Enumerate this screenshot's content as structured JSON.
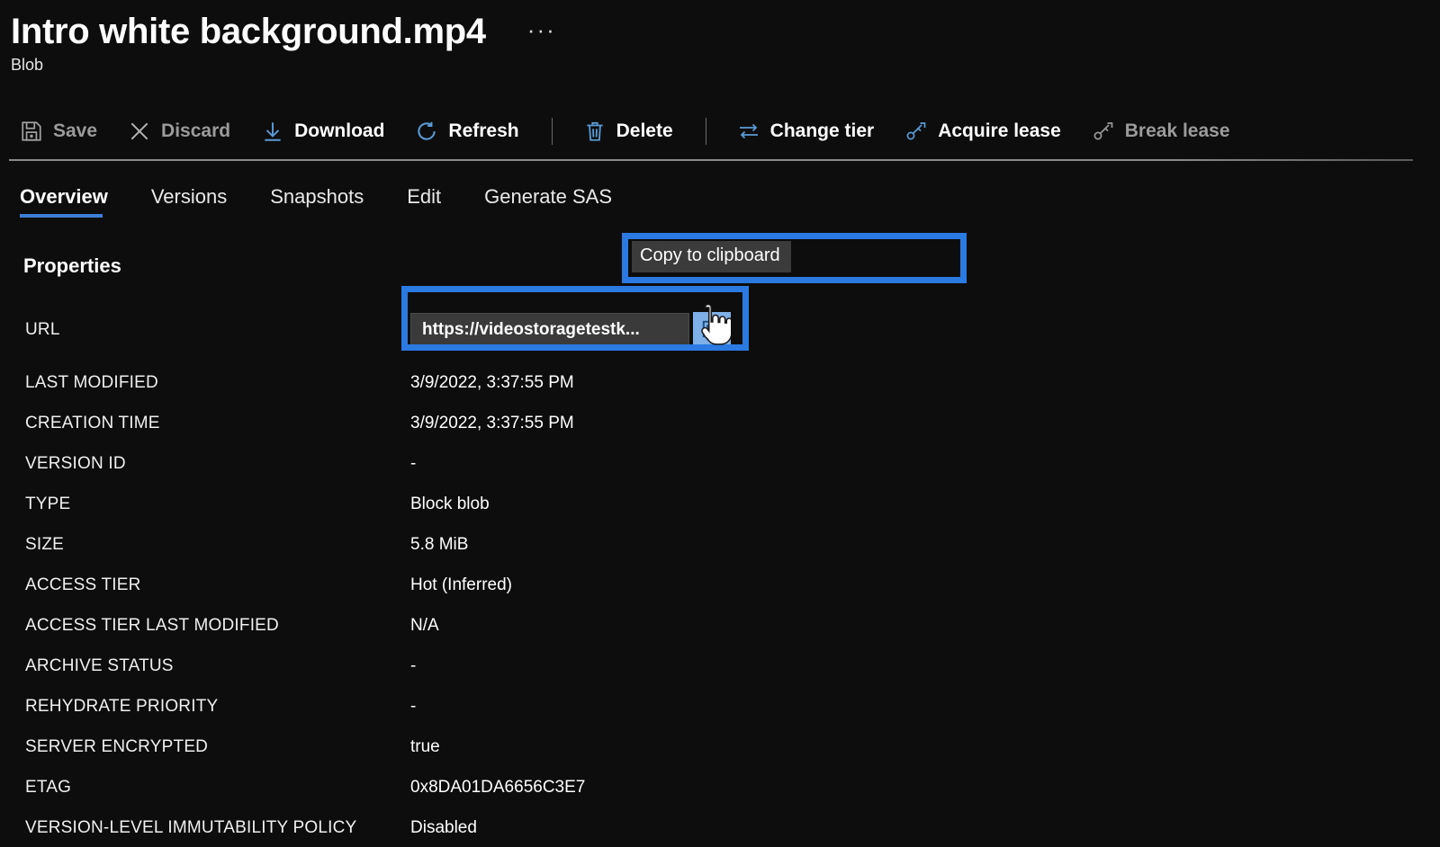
{
  "header": {
    "title": "Intro white background.mp4",
    "ellipsis": "···",
    "subtitle": "Blob"
  },
  "toolbar": {
    "items": [
      {
        "label": "Save",
        "icon": "save-icon",
        "disabled": true
      },
      {
        "label": "Discard",
        "icon": "discard-icon",
        "disabled": true
      },
      {
        "label": "Download",
        "icon": "download-icon",
        "disabled": false
      },
      {
        "label": "Refresh",
        "icon": "refresh-icon",
        "disabled": false
      },
      {
        "label": "Delete",
        "icon": "delete-icon",
        "disabled": false
      },
      {
        "label": "Change tier",
        "icon": "change-tier-icon",
        "disabled": false
      },
      {
        "label": "Acquire lease",
        "icon": "acquire-lease-icon",
        "disabled": false
      },
      {
        "label": "Break lease",
        "icon": "break-lease-icon",
        "disabled": true
      }
    ]
  },
  "tabs": [
    {
      "label": "Overview",
      "active": true
    },
    {
      "label": "Versions",
      "active": false
    },
    {
      "label": "Snapshots",
      "active": false
    },
    {
      "label": "Edit",
      "active": false
    },
    {
      "label": "Generate SAS",
      "active": false
    }
  ],
  "properties": {
    "heading": "Properties",
    "url": {
      "label": "URL",
      "value": "https://videostoragetestk...",
      "copy_icon": "copy-icon"
    },
    "rows": [
      {
        "label": "LAST MODIFIED",
        "value": "3/9/2022, 3:37:55 PM"
      },
      {
        "label": "CREATION TIME",
        "value": "3/9/2022, 3:37:55 PM"
      },
      {
        "label": "VERSION ID",
        "value": "-"
      },
      {
        "label": "TYPE",
        "value": "Block blob"
      },
      {
        "label": "SIZE",
        "value": "5.8 MiB"
      },
      {
        "label": "ACCESS TIER",
        "value": "Hot (Inferred)"
      },
      {
        "label": "ACCESS TIER LAST MODIFIED",
        "value": "N/A"
      },
      {
        "label": "ARCHIVE STATUS",
        "value": "-"
      },
      {
        "label": "REHYDRATE PRIORITY",
        "value": "-"
      },
      {
        "label": "SERVER ENCRYPTED",
        "value": "true"
      },
      {
        "label": "ETAG",
        "value": "0x8DA01DA6656C3E7"
      },
      {
        "label": "VERSION-LEVEL IMMUTABILITY POLICY",
        "value": "Disabled"
      }
    ]
  },
  "tooltip": {
    "text": "Copy to clipboard"
  },
  "annotations": {
    "highlight_color": "#2a7ae2",
    "boxes": [
      "tooltip-highlight",
      "url-field-highlight"
    ]
  },
  "colors": {
    "background": "#0d0d0d",
    "accent": "#3d7fd6",
    "icon_blue": "#5b9bd5",
    "disabled_text": "#9b9b9b",
    "input_background": "#3a3a3a",
    "copy_button_background": "#7fb0e8"
  }
}
